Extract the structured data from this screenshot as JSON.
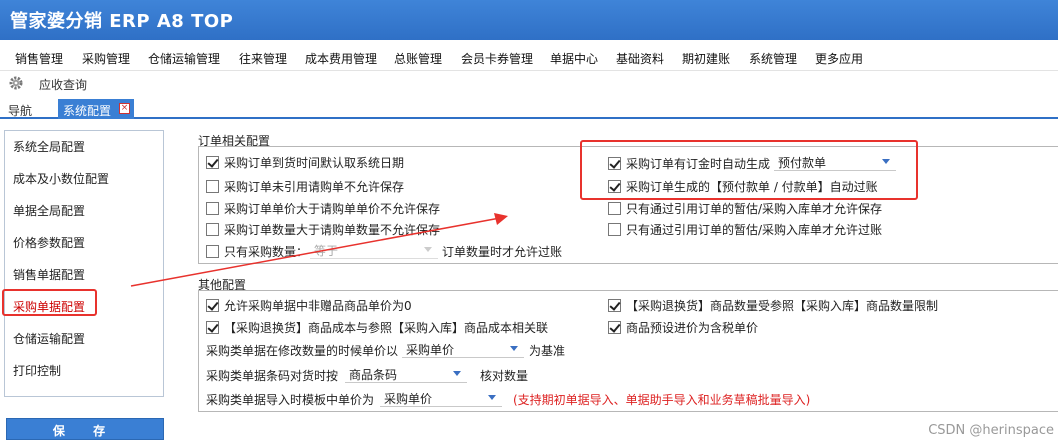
{
  "app": {
    "title": "管家婆分销 ERP A8 TOP"
  },
  "menu": [
    {
      "label": "销售管理",
      "icon": ""
    },
    {
      "label": "采购管理"
    },
    {
      "label": "仓储运输管理"
    },
    {
      "label": "往来管理"
    },
    {
      "label": "成本费用管理"
    },
    {
      "label": "总账管理"
    },
    {
      "label": "会员卡券管理"
    },
    {
      "label": "单据中心"
    },
    {
      "label": "基础资料"
    },
    {
      "label": "期初建账"
    },
    {
      "label": "系统管理"
    },
    {
      "label": "更多应用"
    }
  ],
  "toolbar": {
    "icon": "gear-icon",
    "label": "应收查询"
  },
  "tabs": {
    "nav": "导航",
    "active": "系统配置"
  },
  "sidebar": {
    "items": [
      {
        "label": "系统全局配置"
      },
      {
        "label": "成本及小数位配置"
      },
      {
        "label": "单据全局配置"
      },
      {
        "label": "价格参数配置"
      },
      {
        "label": "销售单据配置"
      },
      {
        "label": "采购单据配置",
        "selected": true
      },
      {
        "label": "仓储运输配置"
      },
      {
        "label": "打印控制"
      }
    ],
    "save_label": "保 存"
  },
  "order_config": {
    "title": "订单相关配置",
    "left": [
      {
        "label": "采购订单到货时间默认取系统日期",
        "checked": true
      },
      {
        "label": "采购订单未引用请购单不允许保存",
        "checked": false
      },
      {
        "label": "采购订单单价大于请购单单价不允许保存",
        "checked": false
      },
      {
        "label": "采购订单数量大于请购单数量不允许保存",
        "checked": false
      }
    ],
    "only_qty": {
      "prefix": "只有采购数量：",
      "select": "等于",
      "suffix": "订单数量时才允许过账",
      "checked": false
    },
    "right": [
      {
        "label": "采购订单有订金时自动生成",
        "checked": true,
        "select": "预付款单"
      },
      {
        "label": "采购订单生成的【预付款单 / 付款单】自动过账",
        "checked": true
      },
      {
        "label": "只有通过引用订单的暂估/采购入库单才允许保存",
        "checked": false
      },
      {
        "label": "只有通过引用订单的暂估/采购入库单才允许过账",
        "checked": false
      }
    ]
  },
  "other_config": {
    "title": "其他配置",
    "left": [
      {
        "label": "允许采购单据中非赠品商品单价为0",
        "checked": true
      },
      {
        "label": "【采购退换货】商品成本与参照【采购入库】商品成本相关联",
        "checked": true
      }
    ],
    "right": [
      {
        "label": "【采购退换货】商品数量受参照【采购入库】商品数量限制",
        "checked": true
      },
      {
        "label": "商品预设进价为含税单价",
        "checked": true
      }
    ],
    "price_row": {
      "prefix": "采购类单据在修改数量的时候单价以",
      "select": "采购单价",
      "suffix": "为基准"
    },
    "barcode_row": {
      "prefix": "采购类单据条码对货时按",
      "select": "商品条码",
      "suffix": "核对数量"
    },
    "import_row": {
      "prefix": "采购类单据导入时模板中单价为",
      "select": "采购单价",
      "note": "(支持期初单据导入、单据助手导入和业务草稿批量导入)"
    }
  },
  "watermark": "CSDN @herinspace",
  "colors": {
    "titlebar": "#2f70c6",
    "highlight": "#e8322d",
    "note": "#dd2222"
  }
}
